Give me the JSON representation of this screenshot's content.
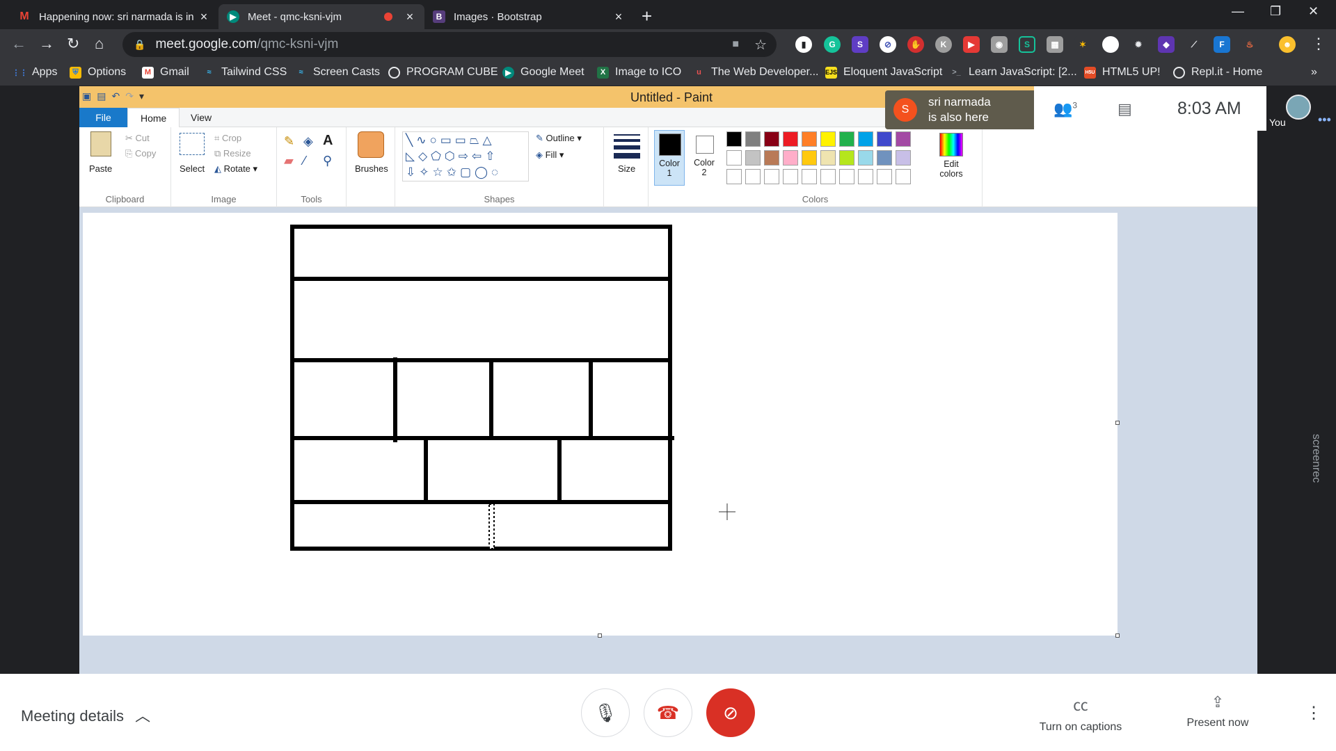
{
  "browser": {
    "tabs": [
      {
        "title": "Happening now: sri narmada is in",
        "favicon": "gmail-icon",
        "active": false
      },
      {
        "title": "Meet - qmc-ksni-vjm",
        "favicon": "meet-icon",
        "active": true
      },
      {
        "title": "Images · Bootstrap",
        "favicon": "bootstrap-icon",
        "active": false
      }
    ],
    "new_tab": "+",
    "url_host": "meet.google.com",
    "url_path": "/qmc-ksni-vjm",
    "bookmarks": [
      {
        "label": "Apps",
        "icon": "apps-grid-icon"
      },
      {
        "label": "Options",
        "icon": "shield-icon"
      },
      {
        "label": "Gmail",
        "icon": "gmail-icon"
      },
      {
        "label": "Tailwind CSS",
        "icon": "tailwind-icon"
      },
      {
        "label": "Screen Casts",
        "icon": "tailwind-icon"
      },
      {
        "label": "PROGRAM CUBE",
        "icon": "globe-icon"
      },
      {
        "label": "Google Meet",
        "icon": "meet-icon"
      },
      {
        "label": "Image to ICO",
        "icon": "excel-icon"
      },
      {
        "label": "The Web Developer...",
        "icon": "udemy-icon"
      },
      {
        "label": "Eloquent JavaScript",
        "icon": "ejs-icon"
      },
      {
        "label": "Learn JavaScript: [2...",
        "icon": "terminal-icon"
      },
      {
        "label": "HTML5 UP!",
        "icon": "html5-icon"
      },
      {
        "label": "Repl.it - Home",
        "icon": "replit-icon"
      }
    ],
    "bookmarks_more": "»"
  },
  "paint": {
    "title": "Untitled - Paint",
    "tabs": {
      "file": "File",
      "home": "Home",
      "view": "View"
    },
    "clipboard": {
      "paste": "Paste",
      "cut": "Cut",
      "copy": "Copy",
      "label": "Clipboard"
    },
    "image": {
      "select": "Select",
      "crop": "Crop",
      "resize": "Resize",
      "rotate": "Rotate",
      "label": "Image"
    },
    "tools": {
      "label": "Tools"
    },
    "brushes": {
      "label": "Brushes"
    },
    "shapes": {
      "label": "Shapes",
      "outline": "Outline",
      "fill": "Fill"
    },
    "size": {
      "label": "Size"
    },
    "colors": {
      "color1": "Color 1",
      "color2": "Color 2",
      "edit": "Edit colors",
      "label": "Colors",
      "palette_row1": [
        "#000000",
        "#7f7f7f",
        "#880015",
        "#ed1c24",
        "#ff7f27",
        "#fff200",
        "#22b14c",
        "#00a2e8",
        "#3f48cc",
        "#a349a4"
      ],
      "palette_row2": [
        "#ffffff",
        "#c3c3c3",
        "#b97a57",
        "#ffaec9",
        "#ffc90e",
        "#efe4b0",
        "#b5e61d",
        "#99d9ea",
        "#7092be",
        "#c8bfe7"
      ]
    }
  },
  "meet": {
    "participant_name": "sri narmada",
    "participant_status": "is also here",
    "participant_initial": "S",
    "people_count": "3",
    "time": "8:03 AM",
    "you_label": "You",
    "meeting_details": "Meeting details",
    "captions": "Turn on captions",
    "present": "Present now",
    "watermark": "screenrec"
  }
}
